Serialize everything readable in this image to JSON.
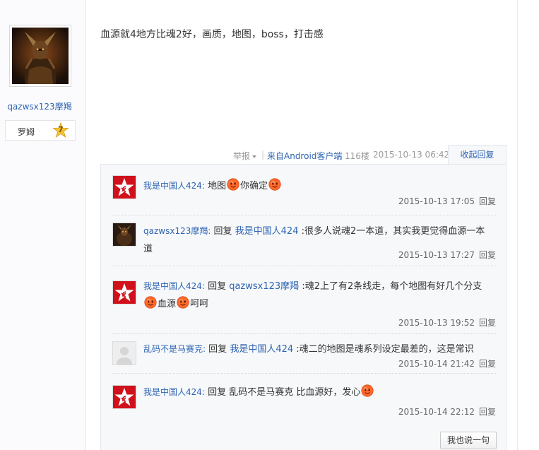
{
  "author": {
    "username": "qazwsx123摩羯",
    "rank_name": "罗姆",
    "rank_level": "7"
  },
  "post": {
    "content": "血源就4地方比魂2好，画质，地图，boss，打击感",
    "report_label": "举报",
    "separator": "|",
    "source": "来自Android客户端",
    "floor": "116楼",
    "time": "2015-10-13 06:42",
    "collapse_label": "收起回复"
  },
  "replies": [
    {
      "avatar": "red-star-avatar",
      "name": "我是中国人424:",
      "prefix": "",
      "target": "",
      "text1": " 地图",
      "text2": "你确定",
      "text3": "",
      "time": "2015-10-13 17:05",
      "reply_label": "回复"
    },
    {
      "avatar": "knight-avatar",
      "name": "qazwsx123摩羯:",
      "prefix": " 回复 ",
      "target": "我是中国人424",
      "text1": " :很多人说魂2一本道，其实我更觉得血源一本道",
      "text2": "",
      "text3": "",
      "time": "2015-10-13 17:27",
      "reply_label": "回复"
    },
    {
      "avatar": "red-star-avatar",
      "name": "我是中国人424:",
      "prefix": " 回复 ",
      "target": "qazwsx123摩羯",
      "text1": " :魂2上了有2条线走，每个地图有好几个分支",
      "text2": "血源",
      "text3": "呵呵",
      "time": "2015-10-13 19:52",
      "reply_label": "回复"
    },
    {
      "avatar": "default-gray-avatar",
      "name": "乱码不是马赛克:",
      "prefix": " 回复 ",
      "target": "我是中国人424",
      "text1": " :魂二的地图是魂系列设定最差的，这是常识",
      "text2": "",
      "text3": "",
      "time": "2015-10-14 21:42",
      "reply_label": "回复"
    },
    {
      "avatar": "red-star-avatar",
      "name": "我是中国人424:",
      "prefix": " 回复 乱码不是马赛克 比血源好，发心",
      "target": "",
      "text1": "",
      "text2": "",
      "text3": "",
      "time": "2015-10-14 22:12",
      "reply_label": "回复"
    }
  ],
  "say_button_label": "我也说一句",
  "emoji_icon": "smiling-face-emoji",
  "colors": {
    "link": "#2d64b3",
    "reply_bg": "#f7f8fa",
    "star_red": "#d0101a",
    "emoji_orange": "#ff6a2a"
  }
}
